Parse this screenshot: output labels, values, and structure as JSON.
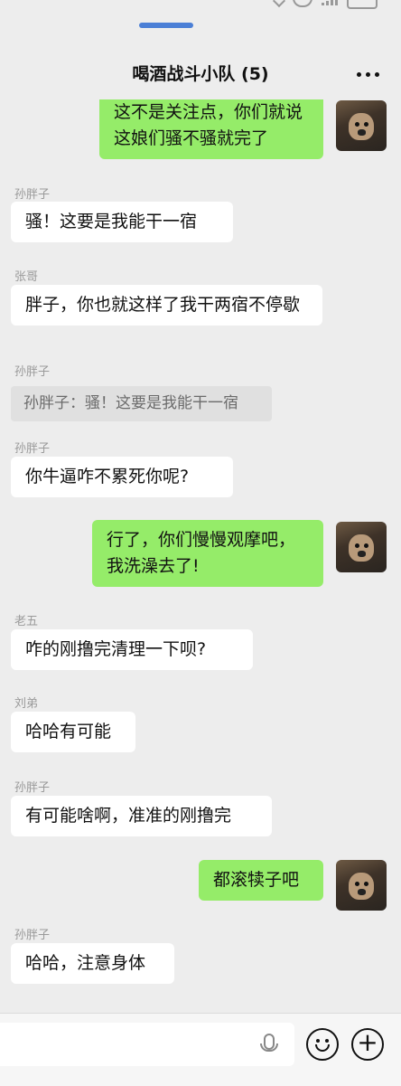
{
  "header": {
    "title": "喝酒战斗小队 (5)"
  },
  "messages": [
    {
      "dir": "out",
      "text": "这不是关注点，你们就说这娘们骚不骚就完了"
    },
    {
      "dir": "in",
      "sender": "孙胖子",
      "text": "骚！这要是我能干一宿"
    },
    {
      "dir": "in",
      "sender": "张哥",
      "text": "胖子，你也就这样了我干两宿不停歇"
    },
    {
      "dir": "in",
      "sender": "孙胖子",
      "quote": "孙胖子：骚！这要是我能干一宿"
    },
    {
      "dir": "in",
      "sender": "孙胖子",
      "text": "你牛逼咋不累死你呢?"
    },
    {
      "dir": "out",
      "text": "行了，你们慢慢观摩吧，我洗澡去了!"
    },
    {
      "dir": "in",
      "sender": "老五",
      "text": "咋的刚撸完清理一下呗?"
    },
    {
      "dir": "in",
      "sender": "刘弟",
      "text": "哈哈有可能"
    },
    {
      "dir": "in",
      "sender": "孙胖子",
      "text": "有可能啥啊，准准的刚撸完"
    },
    {
      "dir": "out",
      "text": "都滚犊子吧"
    },
    {
      "dir": "in",
      "sender": "孙胖子",
      "text": "哈哈，注意身体"
    }
  ],
  "icons": {
    "more": "more-dots-icon",
    "voice": "microphone-icon",
    "emoji": "emoji-icon",
    "plus": "plus-icon"
  },
  "colors": {
    "out_bubble": "#95ec69",
    "in_bubble": "#ffffff",
    "background": "#ededed"
  }
}
